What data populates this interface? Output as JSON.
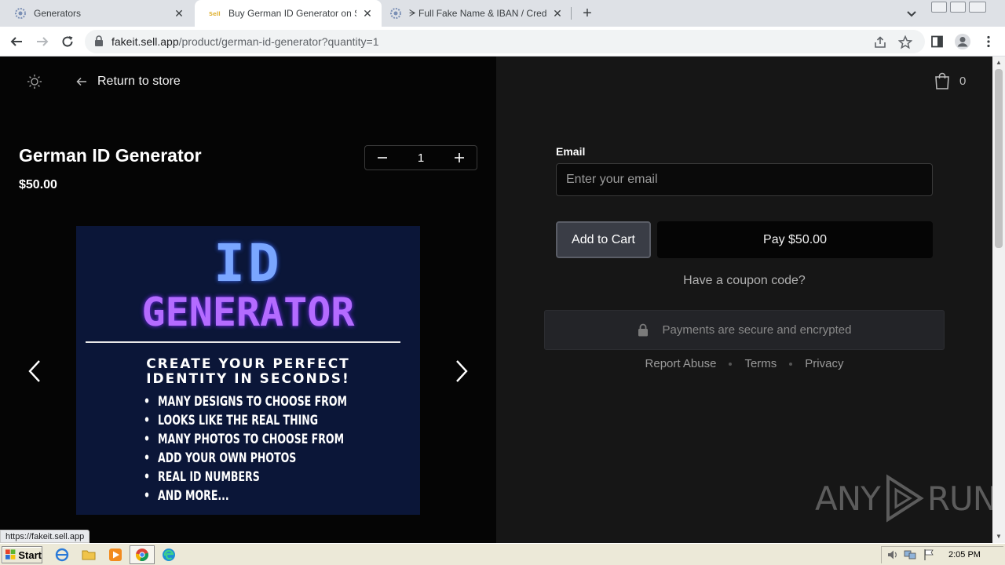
{
  "browser": {
    "tabs": [
      {
        "title": "Generators",
        "active": false
      },
      {
        "title": "Buy German ID Generator on SellApp",
        "active": true
      },
      {
        "title": "ᗒ Full Fake Name & IBAN / Credit Card",
        "active": false
      }
    ],
    "address": {
      "domain": "fakeit.sell.app",
      "path": "/product/german-id-generator?quantity=1"
    },
    "status_url": "https://fakeit.sell.app"
  },
  "page": {
    "return_label": "Return to store",
    "product": {
      "title": "German ID Generator",
      "price": "$50.00",
      "quantity": "1"
    },
    "image": {
      "line1": "ID",
      "line2": "GENERATOR",
      "headline1": "CREATE YOUR PERFECT",
      "headline2": "IDENTITY IN SECONDS!",
      "bullets": [
        "MANY DESIGNS TO CHOOSE FROM",
        "LOOKS LIKE THE REAL THING",
        "MANY PHOTOS TO CHOOSE FROM",
        "ADD YOUR OWN PHOTOS",
        "REAL ID NUMBERS",
        "AND MORE..."
      ]
    },
    "cart_count": "0",
    "checkout": {
      "email_label": "Email",
      "email_placeholder": "Enter your email",
      "email_value": "",
      "add_to_cart": "Add to Cart",
      "pay": "Pay $50.00",
      "coupon": "Have a coupon code?",
      "secure": "Payments are secure and encrypted",
      "links": [
        "Report Abuse",
        "Terms",
        "Privacy"
      ]
    },
    "watermark": {
      "left": "ANY",
      "right": "RUN"
    }
  },
  "taskbar": {
    "start": "Start",
    "clock": "2:05 PM"
  },
  "colors": {
    "left_panel": "#050505",
    "right_panel": "#161616",
    "image_bg": "#0b1638",
    "id_blue": "#7aa6ff",
    "gen_purple": "#b46bff"
  },
  "icons": [
    "sun-icon",
    "arrow-left-icon",
    "minus-icon",
    "plus-icon",
    "chevron-left-icon",
    "chevron-right-icon",
    "shopping-bag-icon",
    "lock-icon"
  ]
}
